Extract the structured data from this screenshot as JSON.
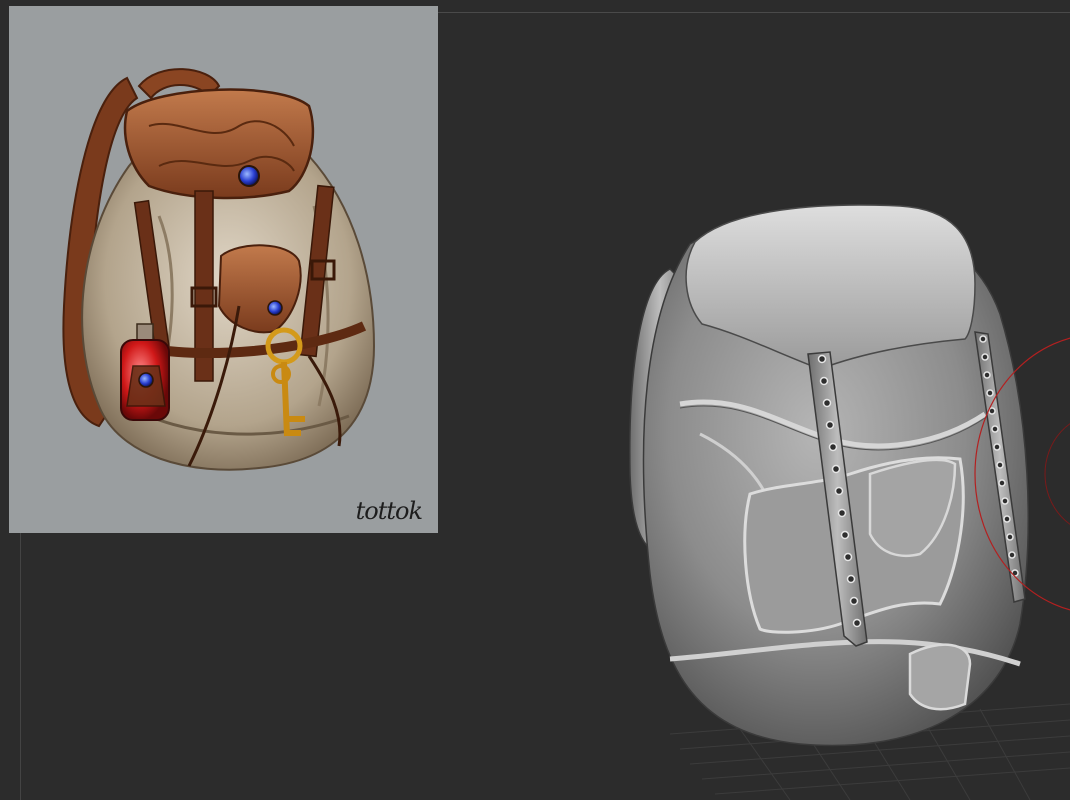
{
  "reference_image": {
    "signature": "tottok",
    "background_color": "#9a9ea0"
  },
  "viewport": {
    "background_color": "#2c2c2c",
    "brush_ring_color": "#b32020"
  }
}
